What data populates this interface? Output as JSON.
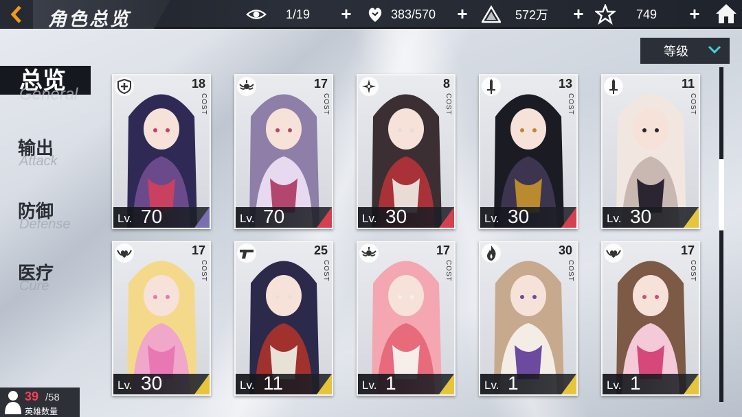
{
  "header": {
    "title": "角色总览",
    "visit_count": "1/19",
    "stamina": "383/570",
    "gold": "572万",
    "gems": "749"
  },
  "sidebar": {
    "items": [
      {
        "cn": "总览",
        "en": "General",
        "active": true
      },
      {
        "cn": "输出",
        "en": "Attack",
        "active": false
      },
      {
        "cn": "防御",
        "en": "Defense",
        "active": false
      },
      {
        "cn": "医疗",
        "en": "Cure",
        "active": false
      }
    ]
  },
  "sort": {
    "label": "等级"
  },
  "cards": [
    {
      "class_icon": "shield-cross-icon",
      "cost": "18",
      "lv_prefix": "Lv.",
      "level": "70",
      "palette": [
        "#2f2a55",
        "#6b4a8c",
        "#c94060"
      ],
      "stripe": "#7a6fb0"
    },
    {
      "class_icon": "wing-emblem-icon",
      "cost": "17",
      "lv_prefix": "Lv.",
      "level": "70",
      "palette": [
        "#8d7fa8",
        "#e7d9ef",
        "#b3466e"
      ],
      "stripe": "#d4404f"
    },
    {
      "class_icon": "shuriken-icon",
      "cost": "8",
      "lv_prefix": "Lv.",
      "level": "30",
      "palette": [
        "#3b2f33",
        "#a83237",
        "#e9dcd7"
      ],
      "stripe": "#d4404f"
    },
    {
      "class_icon": "sword-icon",
      "cost": "13",
      "lv_prefix": "Lv.",
      "level": "30",
      "palette": [
        "#1b1b24",
        "#3d3550",
        "#b98a2e"
      ],
      "stripe": "#d4404f"
    },
    {
      "class_icon": "sword-icon",
      "cost": "11",
      "lv_prefix": "Lv.",
      "level": "30",
      "palette": [
        "#f1e7e0",
        "#c9b7b2",
        "#2a2530"
      ],
      "stripe": "#e6c53a"
    },
    {
      "class_icon": "heart-wing-icon",
      "cost": "17",
      "lv_prefix": "Lv.",
      "level": "30",
      "palette": [
        "#f5d98a",
        "#f0a7c9",
        "#e977b4"
      ],
      "stripe": "#e6c53a"
    },
    {
      "class_icon": "pistol-icon",
      "cost": "25",
      "lv_prefix": "Lv.",
      "level": "11",
      "palette": [
        "#2b2a4a",
        "#a0312c",
        "#e8e1d6"
      ],
      "stripe": "#e6c53a"
    },
    {
      "class_icon": "wing-emblem-icon",
      "cost": "17",
      "lv_prefix": "Lv.",
      "level": "1",
      "palette": [
        "#f4a7b1",
        "#e86b7c",
        "#f6eee9"
      ],
      "stripe": "#e6c53a"
    },
    {
      "class_icon": "flame-icon",
      "cost": "30",
      "lv_prefix": "Lv.",
      "level": "1",
      "palette": [
        "#c7a98d",
        "#f3ede6",
        "#6c4aa0"
      ],
      "stripe": "#e6c53a"
    },
    {
      "class_icon": "heart-wing-icon",
      "cost": "17",
      "lv_prefix": "Lv.",
      "level": "1",
      "palette": [
        "#7d5a45",
        "#f4c9d8",
        "#d6477a"
      ],
      "stripe": "#e6c53a"
    }
  ],
  "hero_count": {
    "current": "39",
    "max": "/58",
    "label": "英雄数量"
  }
}
